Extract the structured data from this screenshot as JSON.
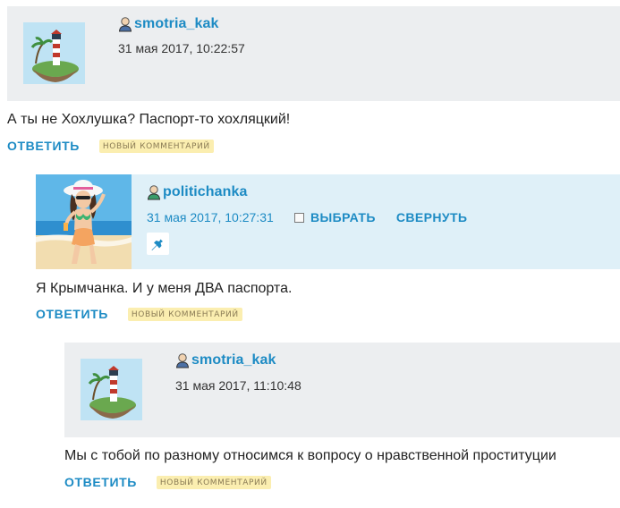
{
  "comments": [
    {
      "username": "smotria_kak",
      "date": "31 мая 2017, 10:22:57",
      "text": "А ты не Хохлушка? Паспорт-то хохляцкий!",
      "reply_label": "ОТВЕТИТЬ",
      "badge": "НОВЫЙ КОММЕНТАРИЙ"
    },
    {
      "username": "politichanka",
      "date": "31 мая 2017, 10:27:31",
      "select_label": "ВЫБРАТЬ",
      "collapse_label": "СВЕРНУТЬ",
      "text": "Я Крымчанка. И у меня ДВА паспорта.",
      "reply_label": "ОТВЕТИТЬ",
      "badge": "НОВЫЙ КОММЕНТАРИЙ"
    },
    {
      "username": "smotria_kak",
      "date": "31 мая 2017, 11:10:48",
      "text": "Мы с тобой по разному относимся к вопросу о нравственной проституции",
      "reply_label": "ОТВЕТИТЬ",
      "badge": "НОВЫЙ КОММЕНТАРИЙ"
    }
  ],
  "icons": {
    "user": "user-icon",
    "pin": "pin-icon",
    "checkbox": "checkbox"
  },
  "colors": {
    "link": "#1d8bc4",
    "header_plain": "#eceef0",
    "header_highlight": "#dff0f8",
    "badge_bg": "#fbeeb0"
  }
}
